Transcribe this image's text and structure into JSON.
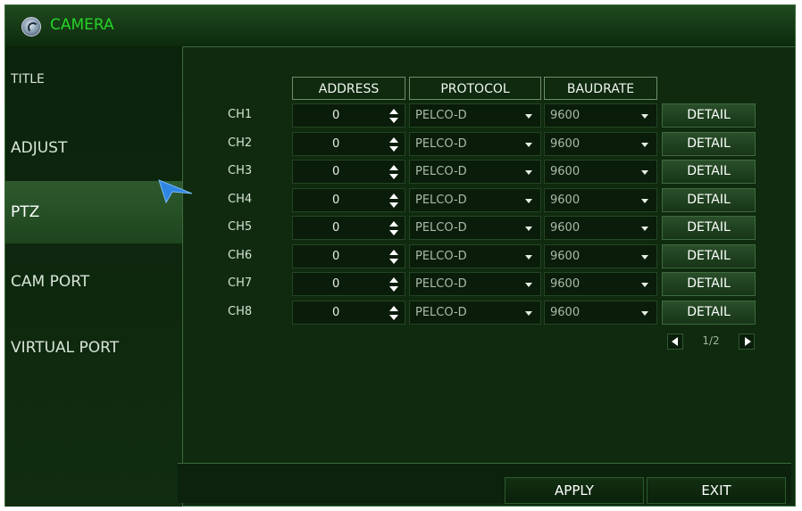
{
  "window": {
    "title": "CAMERA"
  },
  "sidebar": {
    "items": [
      {
        "label": "TITLE"
      },
      {
        "label": "ADJUST"
      },
      {
        "label": "PTZ",
        "active": true
      },
      {
        "label": "CAM PORT"
      },
      {
        "label": "VIRTUAL PORT"
      }
    ]
  },
  "table": {
    "headers": {
      "address": "ADDRESS",
      "protocol": "PROTOCOL",
      "baudrate": "BAUDRATE"
    },
    "rows": [
      {
        "channel": "CH1",
        "address": "0",
        "protocol": "PELCO-D",
        "baudrate": "9600",
        "detail": "DETAIL"
      },
      {
        "channel": "CH2",
        "address": "0",
        "protocol": "PELCO-D",
        "baudrate": "9600",
        "detail": "DETAIL"
      },
      {
        "channel": "CH3",
        "address": "0",
        "protocol": "PELCO-D",
        "baudrate": "9600",
        "detail": "DETAIL"
      },
      {
        "channel": "CH4",
        "address": "0",
        "protocol": "PELCO-D",
        "baudrate": "9600",
        "detail": "DETAIL"
      },
      {
        "channel": "CH5",
        "address": "0",
        "protocol": "PELCO-D",
        "baudrate": "9600",
        "detail": "DETAIL"
      },
      {
        "channel": "CH6",
        "address": "0",
        "protocol": "PELCO-D",
        "baudrate": "9600",
        "detail": "DETAIL"
      },
      {
        "channel": "CH7",
        "address": "0",
        "protocol": "PELCO-D",
        "baudrate": "9600",
        "detail": "DETAIL"
      },
      {
        "channel": "CH8",
        "address": "0",
        "protocol": "PELCO-D",
        "baudrate": "9600",
        "detail": "DETAIL"
      }
    ]
  },
  "pager": {
    "label": "1/2"
  },
  "footer": {
    "apply_label": "APPLY",
    "exit_label": "EXIT"
  },
  "icons": {
    "logo": "camera-logo-icon",
    "spin": "up-down-spinner-icon",
    "dropdown": "caret-down-icon",
    "cursor": "mouse-pointer-icon",
    "prev": "triangle-left-icon",
    "next": "triangle-right-icon"
  },
  "colors": {
    "accent": "#27d327",
    "background": "#0f2a0f",
    "active_item": "#2e5a2e",
    "pointer": "#2f86e3"
  }
}
